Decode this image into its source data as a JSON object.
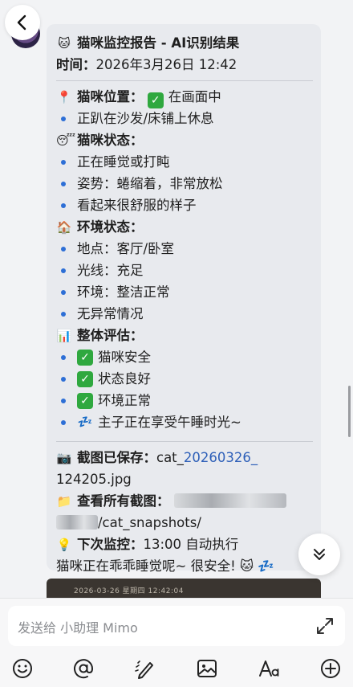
{
  "chat": {
    "contact_name": "小助理 Mimo"
  },
  "report": {
    "title_emoji": "🐱",
    "title": "猫咪监控报告 - AI识别结果",
    "time_label": "时间：",
    "time_value": "2026年3月26日 12:42",
    "sections": [
      {
        "icon": "📍",
        "heading": "猫咪位置：",
        "heading_value": "在画面中",
        "heading_check": true,
        "items": [
          "正趴在沙发/床铺上休息"
        ]
      },
      {
        "icon": "😴",
        "heading": "猫咪状态：",
        "items": [
          "正在睡觉或打盹",
          "姿势：蜷缩着，非常放松",
          "看起来很舒服的样子"
        ]
      },
      {
        "icon": "🏠",
        "heading": "环境状态：",
        "items": [
          "地点：客厅/卧室",
          "光线：充足",
          "环境：整洁正常",
          "无异常情况"
        ]
      },
      {
        "icon": "📊",
        "heading": "整体评估：",
        "items": [
          "猫咪安全",
          "状态良好",
          "环境正常"
        ],
        "last_item_icon": "💤",
        "last_item": "主子正在享受午睡时光~"
      }
    ],
    "screenshot_label": "截图已保存：",
    "screenshot_prefix": "cat_",
    "screenshot_link": "20260326_",
    "screenshot_suffix": "124205.jpg",
    "all_label": "查看所有截图：",
    "snapshots_path": "/cat_snapshots/",
    "next_label": "下次监控：",
    "next_value": "13:00 自动执行",
    "closing": "猫咪正在乖乖睡觉呢~ 很安全! 🐱 💤"
  },
  "preview": {
    "timestamp": "2026-03-26 星期四 12:42:04"
  },
  "input": {
    "placeholder": "发送给 小助理 Mimo"
  },
  "toolbar": [
    "emoji-icon",
    "mention-icon",
    "pen-icon",
    "image-icon",
    "font-icon",
    "add-icon"
  ],
  "colors": {
    "link": "#2d5fb8",
    "bullet": "#2d6fd6",
    "check": "#2fa83f",
    "bubble": "#e8eaee"
  }
}
